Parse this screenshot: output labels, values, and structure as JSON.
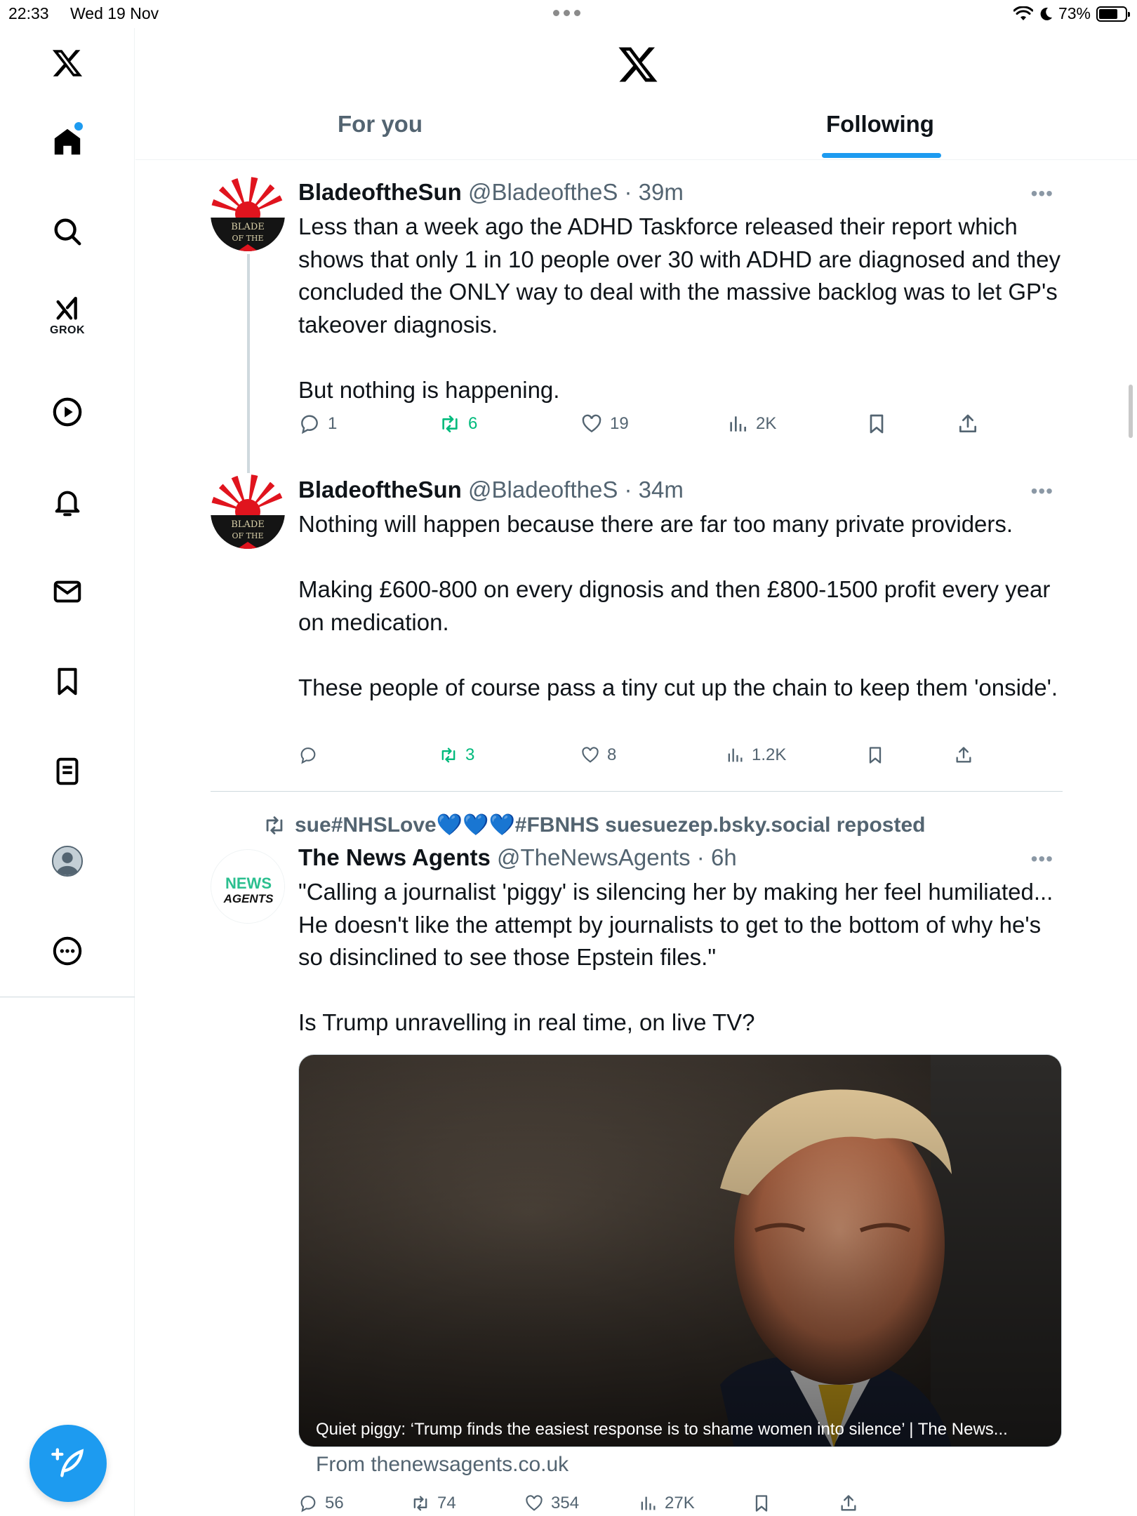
{
  "status_bar": {
    "time": "22:33",
    "date": "Wed 19 Nov",
    "battery": "73%"
  },
  "sidebar": {
    "grok_label": "GROK"
  },
  "header": {
    "tabs": [
      "For you",
      "Following"
    ],
    "active_tab": "Following"
  },
  "tweets": [
    {
      "name": "BladeoftheSun",
      "handle": "@BladeoftheS",
      "time": "39m",
      "text": "Less than a week ago the ADHD Taskforce released their report which shows that only 1 in 10 people over 30 with ADHD are diagnosed and they concluded the ONLY way to deal with the massive backlog was to let GP's takeover diagnosis.\n\nBut nothing is happening.",
      "replies": "1",
      "reposts": "6",
      "likes": "19",
      "views": "2K"
    },
    {
      "name": "BladeoftheSun",
      "handle": "@BladeoftheS",
      "time": "34m",
      "text": "Nothing will happen because there are far too many private providers.\n\nMaking £600-800 on every dignosis and then £800-1500 profit every year on medication.\n\nThese people of course pass a tiny cut up the chain to keep them 'onside'.",
      "replies": "",
      "reposts": "3",
      "likes": "8",
      "views": "1.2K"
    },
    {
      "repost_by": "sue#NHSLove💙💙💙#FBNHS suesuezep.bsky.social reposted",
      "name": "The News Agents",
      "handle": "@TheNewsAgents",
      "time": "6h",
      "text": "\"Calling a journalist 'piggy' is silencing her by making her feel humiliated... He doesn't like the attempt by journalists to get to the bottom of why he's so disinclined to see those Epstein files.\"\n\nIs Trump unravelling in real time, on live TV?",
      "card_title": "Quiet piggy: ‘Trump finds the easiest response is to shame women into silence’ | The News...",
      "card_source": "From thenewsagents.co.uk",
      "replies": "56",
      "reposts": "74",
      "likes": "354",
      "views": "27K"
    }
  ],
  "avatars": {
    "blade_text_1": "BLADE",
    "blade_text_2": "OF THE",
    "newsagents_1": "NEWS",
    "newsagents_2": "AGENTS"
  },
  "colors": {
    "accent": "#1d9bf0",
    "repost_green": "#00ba7c",
    "secondary_text": "#536471"
  }
}
